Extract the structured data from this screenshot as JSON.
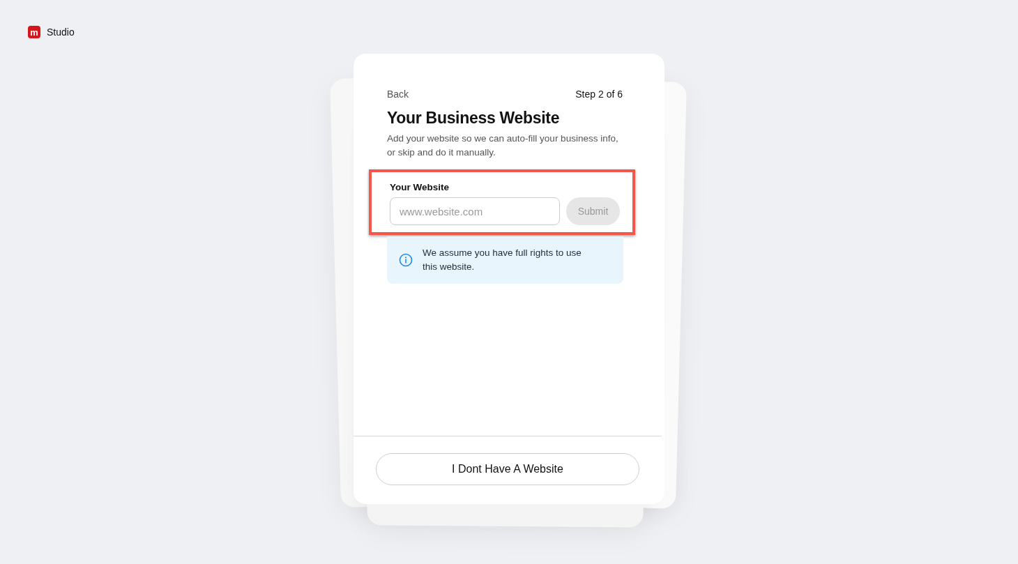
{
  "brand": {
    "name": "Studio",
    "logo_letter": "m"
  },
  "card": {
    "back": "Back",
    "step": "Step 2 of 6",
    "title": "Your Business Website",
    "subtitle": "Add your website so we can auto-fill your business info, or skip and do it manually.",
    "field": {
      "label": "Your Website",
      "placeholder": "www.website.com",
      "highlighted": true
    },
    "submit": {
      "label": "Submit",
      "disabled": true
    },
    "notice": "We assume you have full rights to use this website.",
    "secondary_button": "I Dont Have A Website"
  }
}
